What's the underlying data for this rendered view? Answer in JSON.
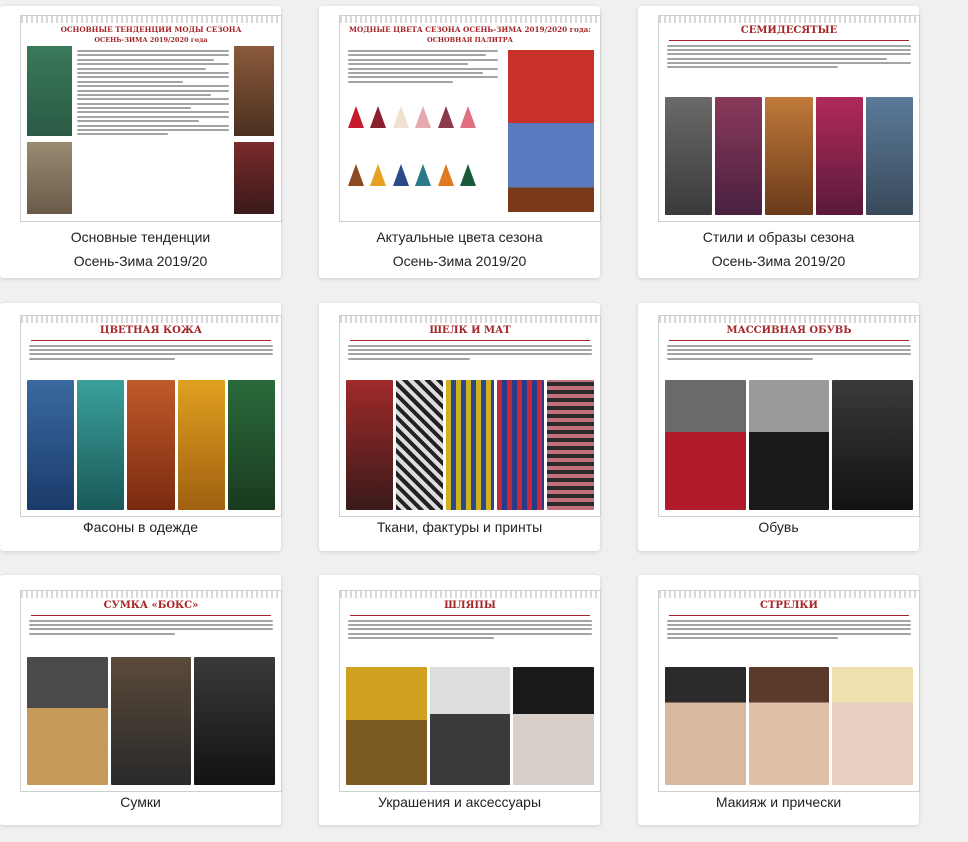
{
  "cards": [
    {
      "caption_line1": "Основные тенденции",
      "caption_line2": "Осень-Зима 2019/20",
      "page_title": "ОСНОВНЫЕ ТЕНДЕНЦИИ МОДЫ СЕЗОНА",
      "page_subtitle": "ОСЕНЬ-ЗИМА 2019/2020 года"
    },
    {
      "caption_line1": "Актуальные цвета сезона",
      "caption_line2": "Осень-Зима 2019/20",
      "page_title": "МОДНЫЕ ЦВЕТА СЕЗОНА ОСЕНЬ-ЗИМА 2019/2020 года:",
      "page_subtitle": "ОСНОВНАЯ ПАЛИТРА"
    },
    {
      "caption_line1": "Стили и образы сезона",
      "caption_line2": "Осень-Зима 2019/20",
      "page_title": "СЕМИДЕСЯТЫЕ"
    },
    {
      "caption_line1": "Фасоны в одежде",
      "page_title": "ЦВЕТНАЯ КОЖА"
    },
    {
      "caption_line1": "Ткани, фактуры и принты",
      "page_title": "ШЕЛК И МАТ"
    },
    {
      "caption_line1": "Обувь",
      "page_title": "МАССИВНАЯ ОБУВЬ"
    },
    {
      "caption_line1": "Сумки",
      "page_title": "СУМКА «БОКС»"
    },
    {
      "caption_line1": "Украшения и аксессуары",
      "page_title": "ШЛЯПЫ"
    },
    {
      "caption_line1": "Макияж и прически",
      "page_title": "СТРЕЛКИ"
    }
  ],
  "colors": {
    "accent": "#a52629",
    "caption": "#222222",
    "background": "#f0f0f0"
  }
}
